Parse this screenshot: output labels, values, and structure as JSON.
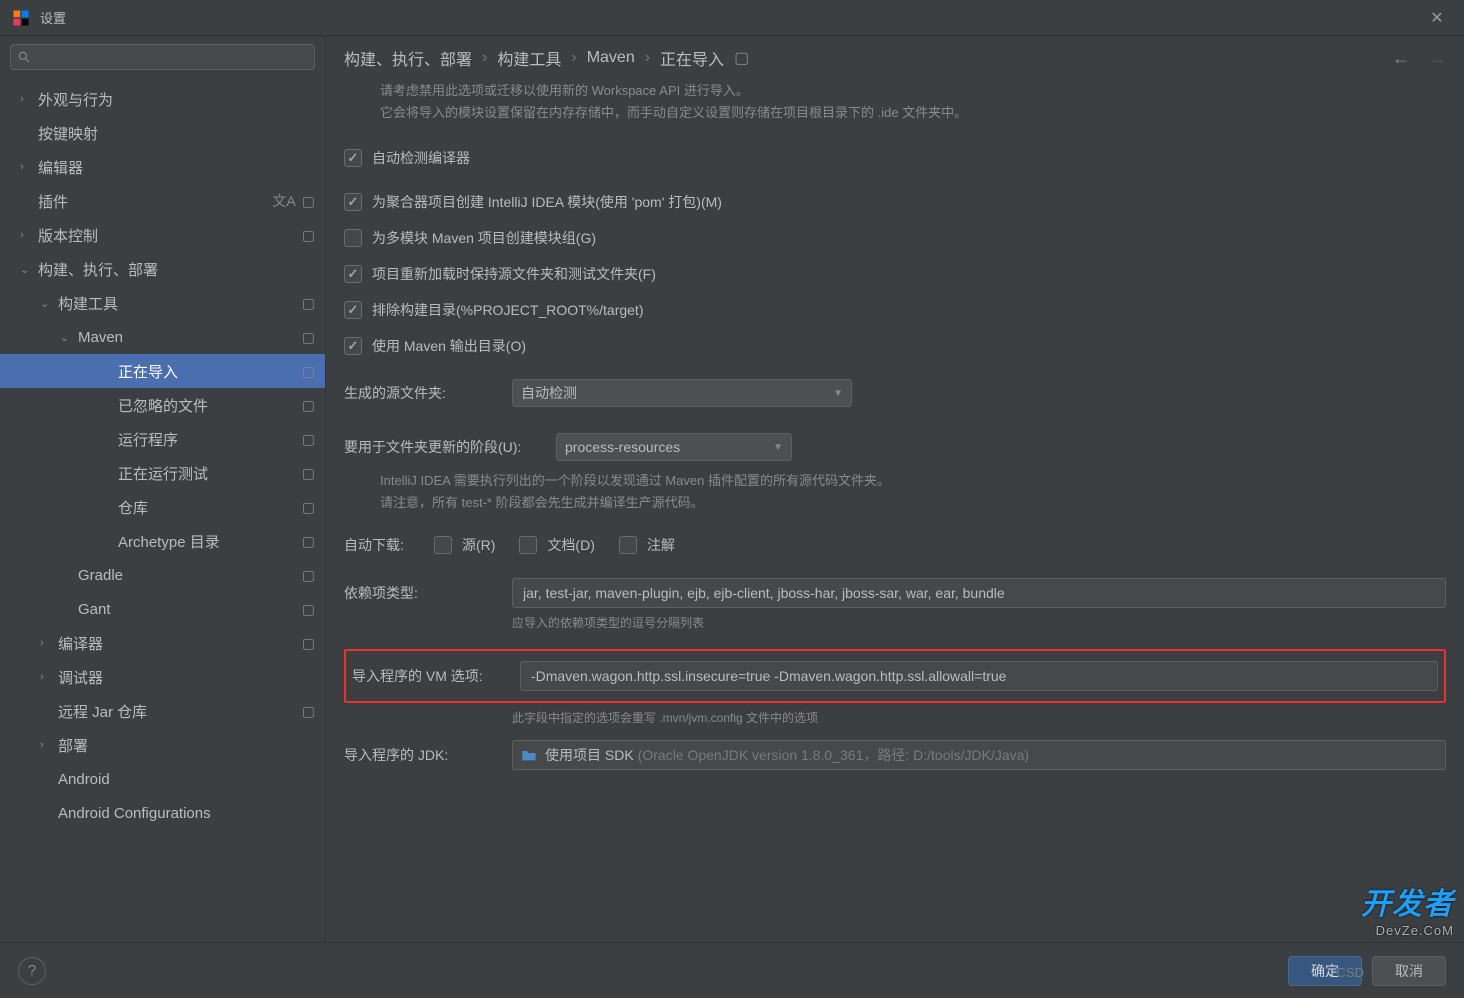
{
  "title": "设置",
  "breadcrumb": [
    "构建、执行、部署",
    "构建工具",
    "Maven",
    "正在导入"
  ],
  "sidebar": {
    "search_placeholder": "",
    "items": [
      {
        "label": "外观与行为",
        "arrow": "›",
        "level": 0
      },
      {
        "label": "按键映射",
        "arrow": "",
        "level": 0
      },
      {
        "label": "编辑器",
        "arrow": "›",
        "level": 0
      },
      {
        "label": "插件",
        "arrow": "",
        "level": 0,
        "lang_badge": true,
        "sq_badge": true
      },
      {
        "label": "版本控制",
        "arrow": "›",
        "level": 0,
        "sq_badge": true
      },
      {
        "label": "构建、执行、部署",
        "arrow": "⌄",
        "level": 0
      },
      {
        "label": "构建工具",
        "arrow": "⌄",
        "level": 1,
        "sq_badge": true
      },
      {
        "label": "Maven",
        "arrow": "⌄",
        "level": 2,
        "sq_badge": true
      },
      {
        "label": "正在导入",
        "arrow": "",
        "level": 3,
        "selected": true,
        "sq_badge": true
      },
      {
        "label": "已忽略的文件",
        "arrow": "",
        "level": 3,
        "sq_badge": true
      },
      {
        "label": "运行程序",
        "arrow": "",
        "level": 3,
        "sq_badge": true
      },
      {
        "label": "正在运行测试",
        "arrow": "",
        "level": 3,
        "sq_badge": true
      },
      {
        "label": "仓库",
        "arrow": "",
        "level": 3,
        "sq_badge": true
      },
      {
        "label": "Archetype 目录",
        "arrow": "",
        "level": 3,
        "sq_badge": true
      },
      {
        "label": "Gradle",
        "arrow": "",
        "level": 2,
        "sq_badge": true
      },
      {
        "label": "Gant",
        "arrow": "",
        "level": 2,
        "sq_badge": true
      },
      {
        "label": "编译器",
        "arrow": "›",
        "level": 1,
        "sq_badge": true
      },
      {
        "label": "调试器",
        "arrow": "›",
        "level": 1
      },
      {
        "label": "远程 Jar 仓库",
        "arrow": "",
        "level": 1,
        "sq_badge": true
      },
      {
        "label": "部署",
        "arrow": "›",
        "level": 1
      },
      {
        "label": "Android",
        "arrow": "",
        "level": 1
      },
      {
        "label": "Android Configurations",
        "arrow": "",
        "level": 1
      }
    ]
  },
  "panel": {
    "info1": "请考虑禁用此选项或迁移以使用新的 Workspace API 进行导入。",
    "info2": "它会将导入的模块设置保留在内存存储中，而手动自定义设置则存储在项目根目录下的 .ide 文件夹中。",
    "cb_auto_detect": "自动检测编译器",
    "cb_aggregator": "为聚合器项目创建 IntelliJ IDEA 模块(使用 'pom' 打包)(M)",
    "cb_multi_module": "为多模块 Maven 项目创建模块组(G)",
    "cb_keep_src": "项目重新加载时保持源文件夹和测试文件夹(F)",
    "cb_exclude_build": "排除构建目录(%PROJECT_ROOT%/target)",
    "cb_maven_output": "使用 Maven 输出目录(O)",
    "label_gen_src": "生成的源文件夹:",
    "dd_gen_src": "自动检测",
    "label_phase": "要用于文件夹更新的阶段(U):",
    "dd_phase": "process-resources",
    "phase_hint1": "IntelliJ IDEA 需要执行列出的一个阶段以发现通过 Maven 插件配置的所有源代码文件夹。",
    "phase_hint2": "请注意，所有 test-* 阶段都会先生成并编译生产源代码。",
    "label_auto_dl": "自动下载:",
    "cb_src": "源(R)",
    "cb_doc": "文档(D)",
    "cb_anno": "注解",
    "label_dep_types": "依赖项类型:",
    "val_dep_types": "jar, test-jar, maven-plugin, ejb, ejb-client, jboss-har, jboss-sar, war, ear, bundle",
    "hint_dep_types": "应导入的依赖项类型的逗号分隔列表",
    "label_vm_opts": "导入程序的 VM 选项:",
    "val_vm_opts": "-Dmaven.wagon.http.ssl.insecure=true -Dmaven.wagon.http.ssl.allowall=true",
    "hint_vm_opts": "此字段中指定的选项会重写 .mvn/jvm.config 文件中的选项",
    "label_jdk": "导入程序的 JDK:",
    "val_jdk_primary": "使用项目 SDK",
    "val_jdk_secondary": "(Oracle OpenJDK version 1.8.0_361，路径: D:/tools/JDK/Java)"
  },
  "footer": {
    "ok": "确定",
    "cancel": "取消"
  },
  "watermark": {
    "main": "开发者",
    "sub": "DevZe.CoM",
    "csd": "CSD"
  }
}
